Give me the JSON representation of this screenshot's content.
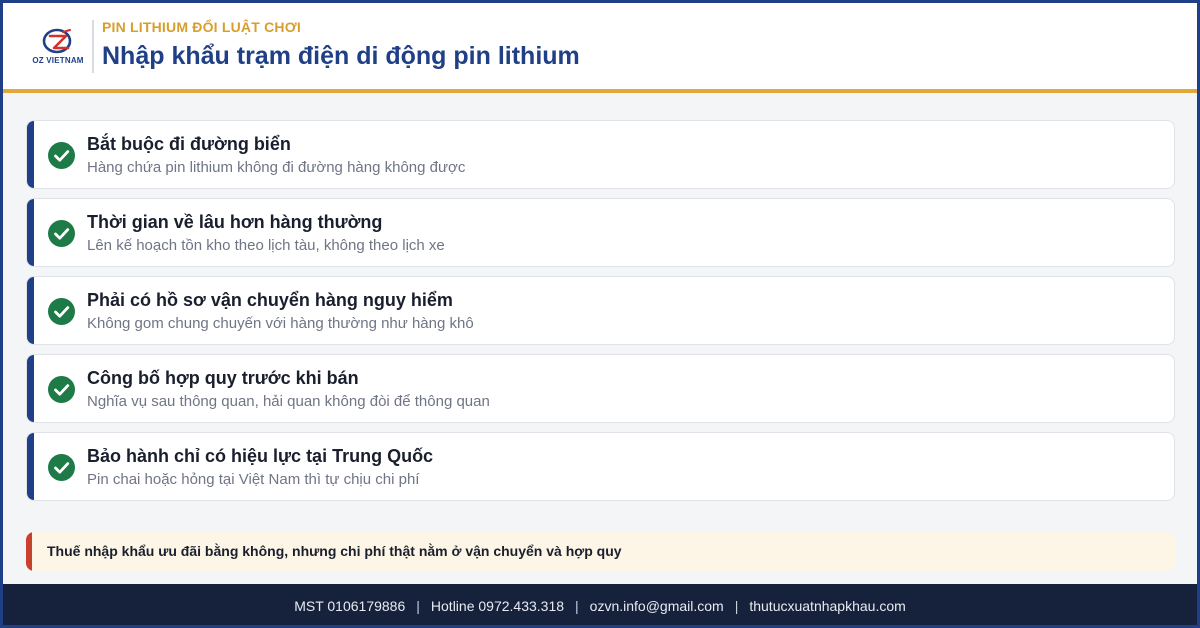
{
  "brand": {
    "logo_text": "OZ VIETNAM",
    "accent": "#1f3f86",
    "gold": "#d79e2d",
    "red": "#c8412f"
  },
  "header": {
    "kicker": "PIN LITHIUM ĐỔI LUẬT CHƠI",
    "title": "Nhập khẩu trạm điện di động pin lithium"
  },
  "items": [
    {
      "icon": "check-circle-icon",
      "title": "Bắt buộc đi đường biển",
      "subtitle": "Hàng chứa pin lithium không đi đường hàng không được"
    },
    {
      "icon": "check-circle-icon",
      "title": "Thời gian về lâu hơn hàng thường",
      "subtitle": "Lên kế hoạch tồn kho theo lịch tàu, không theo lịch xe"
    },
    {
      "icon": "check-circle-icon",
      "title": "Phải có hồ sơ vận chuyển hàng nguy hiểm",
      "subtitle": "Không gom chung chuyến với hàng thường như hàng khô"
    },
    {
      "icon": "check-circle-icon",
      "title": "Công bố hợp quy trước khi bán",
      "subtitle": "Nghĩa vụ sau thông quan, hải quan không đòi để thông quan"
    },
    {
      "icon": "check-circle-icon",
      "title": "Bảo hành chỉ có hiệu lực tại Trung Quốc",
      "subtitle": "Pin chai hoặc hỏng tại Việt Nam thì tự chịu chi phí"
    }
  ],
  "note": {
    "text": "Thuế nhập khẩu ưu đãi bằng không, nhưng chi phí thật nằm ở vận chuyển và hợp quy"
  },
  "footer": {
    "mst": "MST 0106179886",
    "hotline": "Hotline 0972.433.318",
    "email": "ozvn.info@gmail.com",
    "website": "thutucxuatnhapkhau.com",
    "separator": "|"
  }
}
